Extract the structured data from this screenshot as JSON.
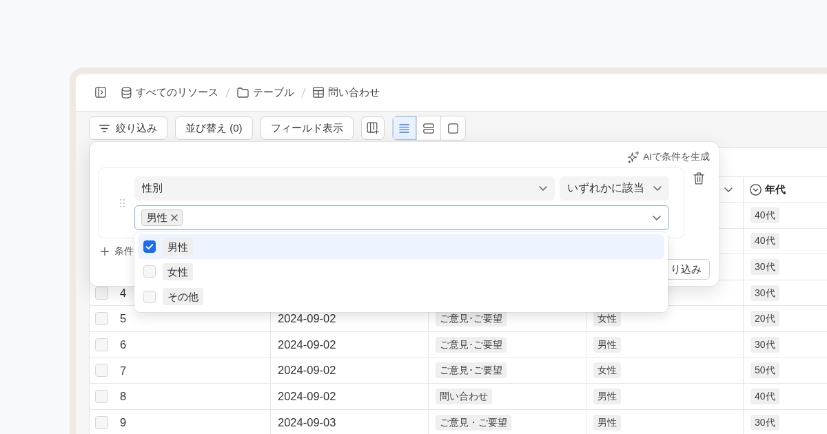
{
  "breadcrumb": [
    {
      "kind": "database",
      "label": "すべてのリソース"
    },
    {
      "kind": "folder",
      "label": "テーブル"
    },
    {
      "kind": "table",
      "label": "問い合わせ"
    }
  ],
  "toolbar": {
    "buttons": [
      {
        "kind": "filter",
        "label": "絞り込み"
      },
      {
        "kind": "text",
        "label": "並び替え (0)"
      },
      {
        "kind": "text",
        "label": "フィールド表示"
      },
      {
        "kind": "add_column"
      }
    ],
    "view_modes": [
      {
        "kind": "list",
        "selected": true
      },
      {
        "kind": "stacked",
        "selected": false
      },
      {
        "kind": "single",
        "selected": false
      }
    ]
  },
  "table": {
    "header": {
      "column_5": "年代"
    },
    "rows": [
      {
        "column_5": "40代"
      },
      {
        "column_5": "40代"
      },
      {
        "column_5": "30代"
      },
      {
        "checked": false,
        "column_1": "4",
        "column_5": "30代"
      },
      {
        "checked": false,
        "column_1": "5",
        "column_2": "2024-09-02",
        "column_3": "ご意見･ご要望",
        "column_4": "女性",
        "column_5": "20代"
      },
      {
        "checked": false,
        "column_1": "6",
        "column_2": "2024-09-02",
        "column_3": "ご意見･ご要望",
        "column_4": "男性",
        "column_5": "30代"
      },
      {
        "checked": false,
        "column_1": "7",
        "column_2": "2024-09-02",
        "column_3": "ご意見･ご要望",
        "column_4": "女性",
        "column_5": "50代"
      },
      {
        "checked": false,
        "column_1": "8",
        "column_2": "2024-09-02",
        "column_3": "問い合わせ",
        "column_4": "男性",
        "column_5": "40代"
      },
      {
        "checked": false,
        "column_1": "9",
        "column_2": "2024-09-03",
        "column_3": "ご意見・ご要望",
        "column_4": "男性",
        "column_5": "30代"
      }
    ]
  },
  "filter_panel": {
    "ai_button": "AIで条件を生成",
    "conditions": [
      {
        "field": "性別",
        "operator": "いずれかに該当",
        "values": [
          "男性"
        ]
      }
    ],
    "add_condition": "条件",
    "apply_button": "り込み"
  },
  "value_dropdown": {
    "options": [
      {
        "label": "男性",
        "checked": true
      },
      {
        "label": "女性",
        "checked": false
      },
      {
        "label": "その他",
        "checked": false
      }
    ]
  }
}
